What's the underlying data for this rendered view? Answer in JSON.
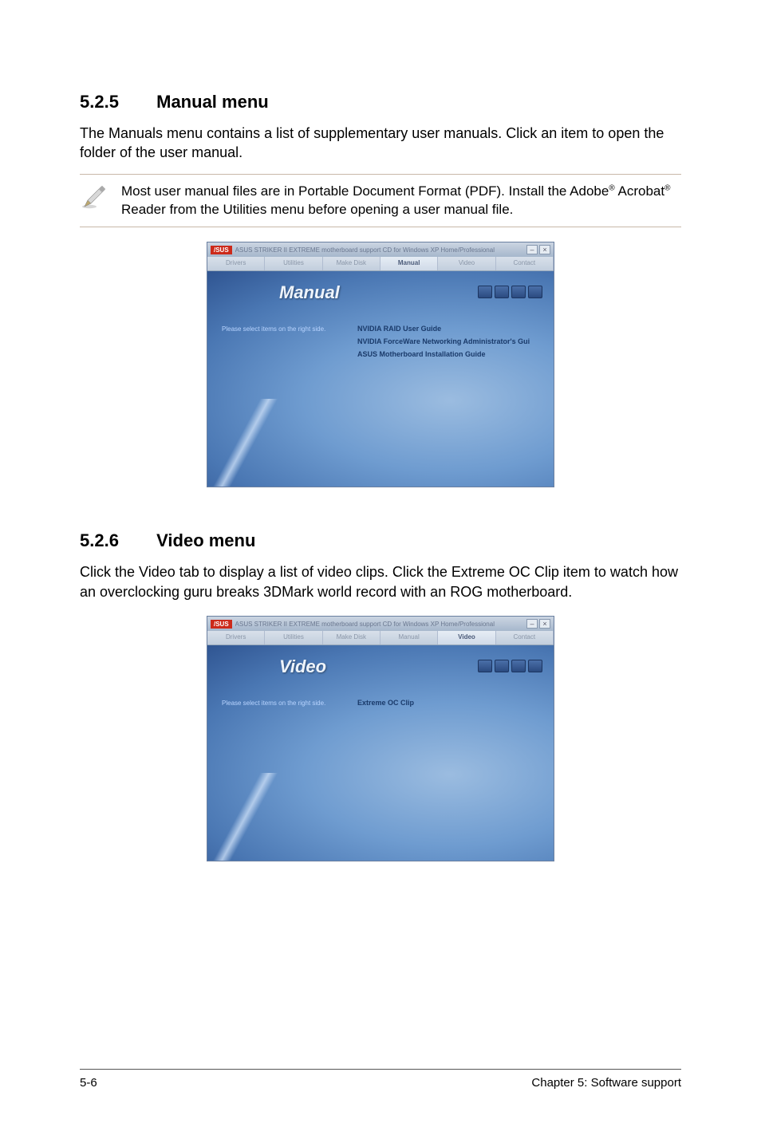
{
  "section1": {
    "number": "5.2.5",
    "title": "Manual menu",
    "paragraph": "The Manuals menu contains a list of supplementary user manuals. Click an item to open the folder of the user manual.",
    "note": {
      "part1": "Most user manual files are in Portable Document Format (PDF). Install the Adobe",
      "reg1": "®",
      "part2": " Acrobat",
      "reg2": "®",
      "part3": " Reader from the Utilities menu before opening a user manual file."
    },
    "screenshot": {
      "logo": "/SUS",
      "windowTitle": "ASUS STRIKER II EXTREME motherboard support CD for Windows XP Home/Professional",
      "tabs": [
        "Drivers",
        "Utilities",
        "Make Disk",
        "Manual",
        "Video",
        "Contact"
      ],
      "activeTab": 3,
      "sectionTitle": "Manual",
      "prompt": "Please select items on the right side.",
      "items": [
        "NVIDIA RAID User Guide",
        "NVIDIA ForceWare Networking Administrator's Gui",
        "ASUS Motherboard Installation Guide"
      ]
    }
  },
  "section2": {
    "number": "5.2.6",
    "title": "Video menu",
    "paragraph": "Click the Video tab to display a list of video clips. Click the Extreme OC Clip item to watch how an overclocking guru breaks 3DMark world record with an ROG motherboard.",
    "screenshot": {
      "logo": "/SUS",
      "windowTitle": "ASUS STRIKER II EXTREME motherboard support CD for Windows XP Home/Professional",
      "tabs": [
        "Drivers",
        "Utilities",
        "Make Disk",
        "Manual",
        "Video",
        "Contact"
      ],
      "activeTab": 4,
      "sectionTitle": "Video",
      "prompt": "Please select items on the right side.",
      "items": [
        "Extreme OC Clip"
      ]
    }
  },
  "footer": {
    "left": "5-6",
    "right": "Chapter 5: Software support"
  }
}
